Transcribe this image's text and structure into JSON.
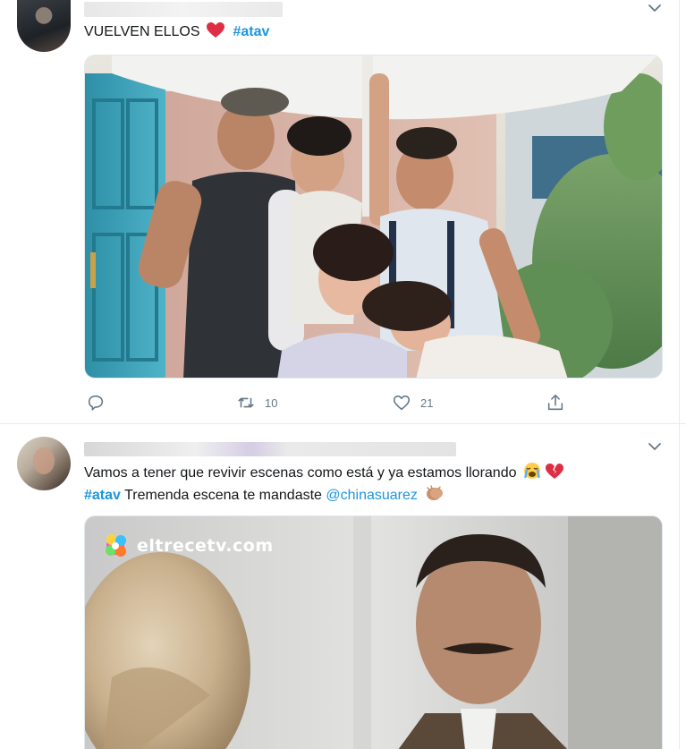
{
  "tweets": [
    {
      "text_main": "VUELVEN ELLOS",
      "hashtag": "#atav",
      "emoji_1": "heart-red",
      "media": "photo-group-of-five",
      "actions": {
        "retweets": "10",
        "likes": "21"
      }
    },
    {
      "line1_text": "Vamos a tener que revivir escenas como está y ya estamos llorando",
      "line1_emojis": [
        "loudly-crying-face",
        "broken-heart"
      ],
      "line2_hashtag": "#atav",
      "line2_text": " Tremenda escena te mandaste ",
      "line2_mention": "@chinasuarez",
      "line2_emoji": "clapping-hands",
      "media": "tv-scene-still",
      "watermark": "eltrecetv.com"
    }
  ],
  "colors": {
    "link": "#1b95e0",
    "text": "#14171a",
    "muted": "#657786",
    "border": "#e6ecf0",
    "heart": "#e0245e"
  }
}
